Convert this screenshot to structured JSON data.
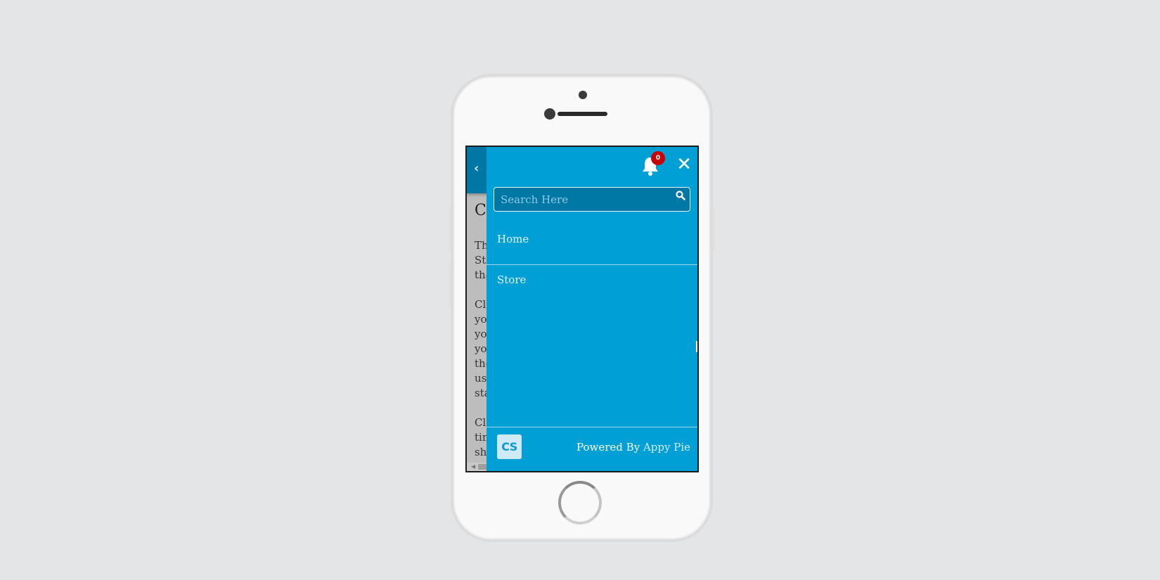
{
  "page": {
    "title_partial": "Cl",
    "paragraphs": [
      [
        "Th",
        "Sto",
        "tha"
      ],
      [
        "Clo",
        "you",
        "you",
        "you",
        "the",
        "use",
        "sta"
      ],
      [
        "Clo",
        "tim",
        "sho"
      ]
    ],
    "back_icon": "chevron-left-icon"
  },
  "drawer": {
    "notifications": {
      "icon": "bell-icon",
      "count": "0"
    },
    "close_label": "✕",
    "search": {
      "placeholder": "Search Here",
      "value": ""
    },
    "menu": [
      {
        "label": "Home"
      },
      {
        "label": "Store"
      }
    ],
    "footer": {
      "logo_text": "CS",
      "powered_by": "Powered By",
      "brand": "Appy Pie"
    }
  },
  "colors": {
    "drawer_bg": "#00a0d6",
    "header_bg": "#0077a5",
    "badge": "#c8000a",
    "page_bg": "#e4e5e7"
  }
}
